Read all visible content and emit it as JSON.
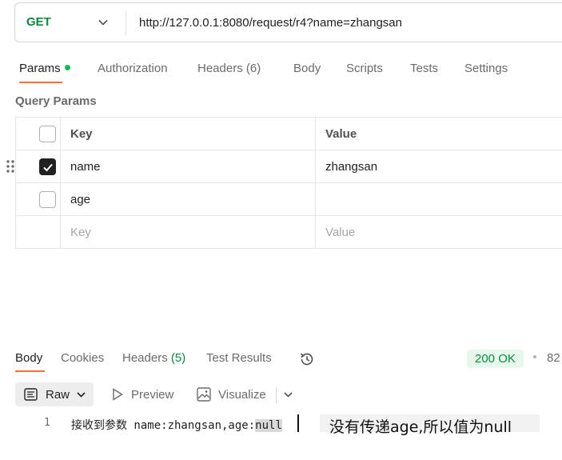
{
  "request": {
    "method": "GET",
    "url": "http://127.0.0.1:8080/request/r4?name=zhangsan"
  },
  "request_tabs": [
    {
      "label": "Params",
      "active": true
    },
    {
      "label": "Authorization"
    },
    {
      "label": "Headers (6)"
    },
    {
      "label": "Body"
    },
    {
      "label": "Scripts"
    },
    {
      "label": "Tests"
    },
    {
      "label": "Settings"
    }
  ],
  "query_params": {
    "title": "Query Params",
    "headers": {
      "key": "Key",
      "value": "Value"
    },
    "rows": [
      {
        "checked": true,
        "key": "name",
        "value": "zhangsan"
      },
      {
        "checked": false,
        "key": "age",
        "value": ""
      }
    ],
    "placeholder": {
      "key": "Key",
      "value": "Value"
    }
  },
  "response": {
    "tabs": [
      {
        "label": "Body",
        "active": true
      },
      {
        "label": "Cookies"
      },
      {
        "label": "Headers",
        "count": "(5)"
      },
      {
        "label": "Test Results"
      }
    ],
    "status": "200 OK",
    "time_partial": "82",
    "toolbar": {
      "raw": "Raw",
      "preview": "Preview",
      "visualize": "Visualize"
    },
    "line_number": "1",
    "body_prefix": "接收到参数 name:zhangsan,age:",
    "body_highlight": "null"
  },
  "annotation": "没有传递age,所以值为null",
  "icons": {
    "method_chevron": "chevron-down-icon",
    "history": "history-icon",
    "raw": "raw-text-icon",
    "preview": "play-icon",
    "visualize": "image-icon"
  },
  "colors": {
    "accent": "#ff6c37",
    "success": "#0b8a3e",
    "params_dot": "#0cbb52"
  }
}
